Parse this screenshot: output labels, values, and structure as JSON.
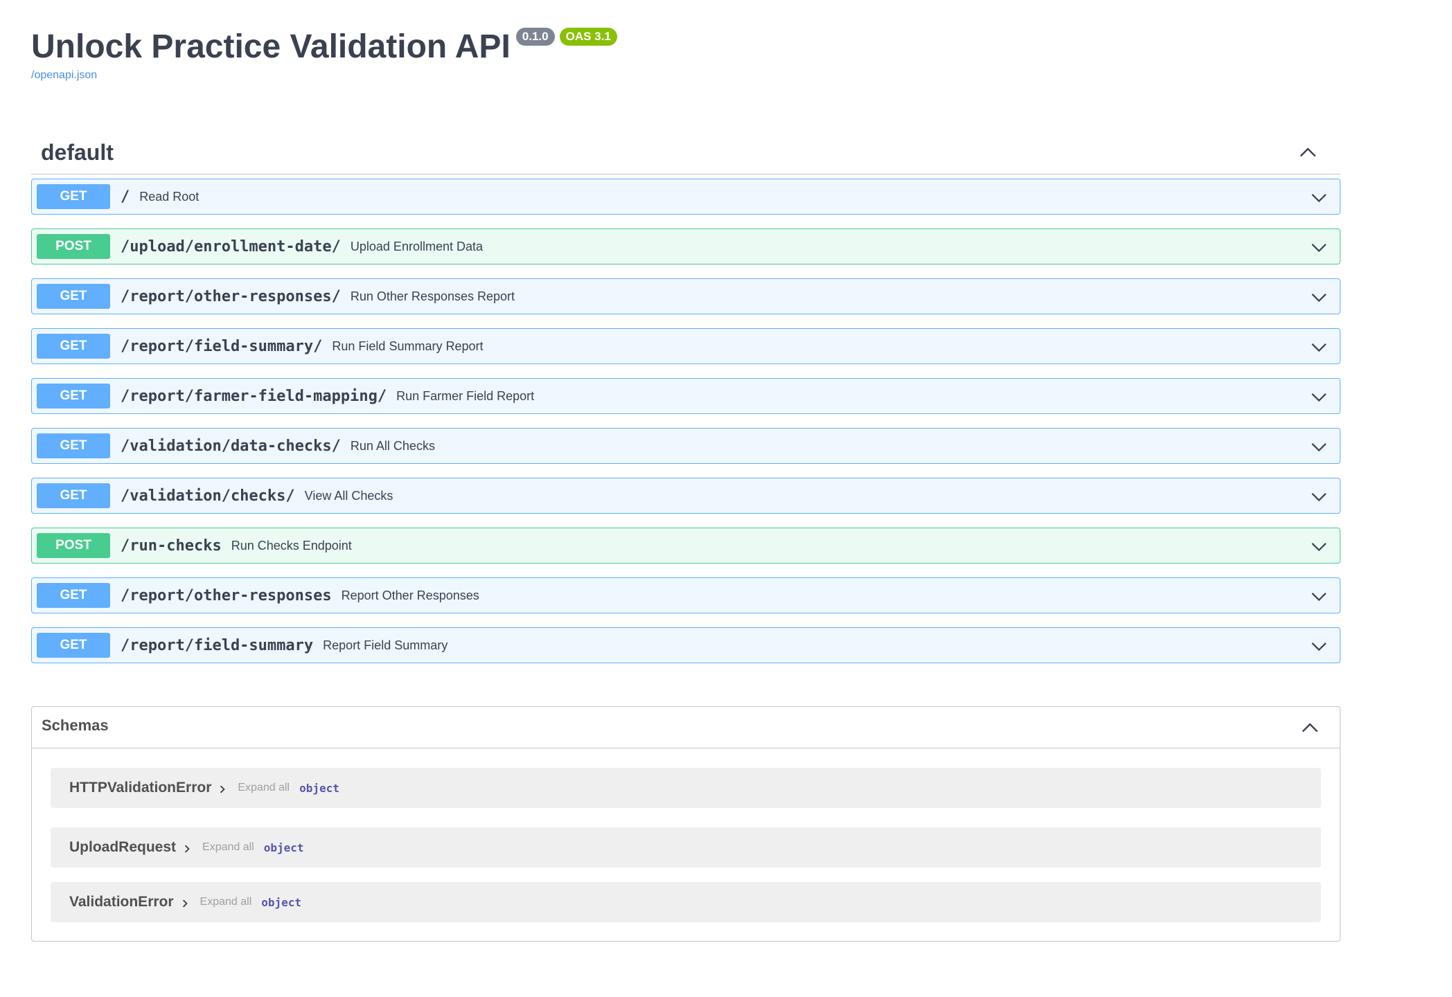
{
  "header": {
    "title": "Unlock Practice Validation API",
    "version_badge": "0.1.0",
    "oas_badge": "OAS 3.1",
    "spec_link": "/openapi.json"
  },
  "tag": {
    "name": "default",
    "toggle_icon": "chevron-up-icon"
  },
  "operations": [
    {
      "method": "GET",
      "path": "/",
      "summary": "Read Root"
    },
    {
      "method": "POST",
      "path": "/upload/enrollment-date/",
      "summary": "Upload Enrollment Data"
    },
    {
      "method": "GET",
      "path": "/report/other-responses/",
      "summary": "Run Other Responses Report"
    },
    {
      "method": "GET",
      "path": "/report/field-summary/",
      "summary": "Run Field Summary Report"
    },
    {
      "method": "GET",
      "path": "/report/farmer-field-mapping/",
      "summary": "Run Farmer Field Report"
    },
    {
      "method": "GET",
      "path": "/validation/data-checks/",
      "summary": "Run All Checks"
    },
    {
      "method": "GET",
      "path": "/validation/checks/",
      "summary": "View All Checks"
    },
    {
      "method": "POST",
      "path": "/run-checks",
      "summary": "Run Checks Endpoint"
    },
    {
      "method": "GET",
      "path": "/report/other-responses",
      "summary": "Report Other Responses"
    },
    {
      "method": "GET",
      "path": "/report/field-summary",
      "summary": "Report Field Summary"
    }
  ],
  "schemas": {
    "title": "Schemas",
    "models": [
      {
        "name": "HTTPValidationError",
        "expand_label": "Expand all",
        "type": "object"
      },
      {
        "name": "UploadRequest",
        "expand_label": "Expand all",
        "type": "object"
      },
      {
        "name": "ValidationError",
        "expand_label": "Expand all",
        "type": "object"
      }
    ]
  },
  "colors": {
    "get": "#61affe",
    "post": "#49cc90",
    "version_badge": "#7d8492",
    "oas_badge": "#89bf04",
    "link": "#4990e2"
  }
}
